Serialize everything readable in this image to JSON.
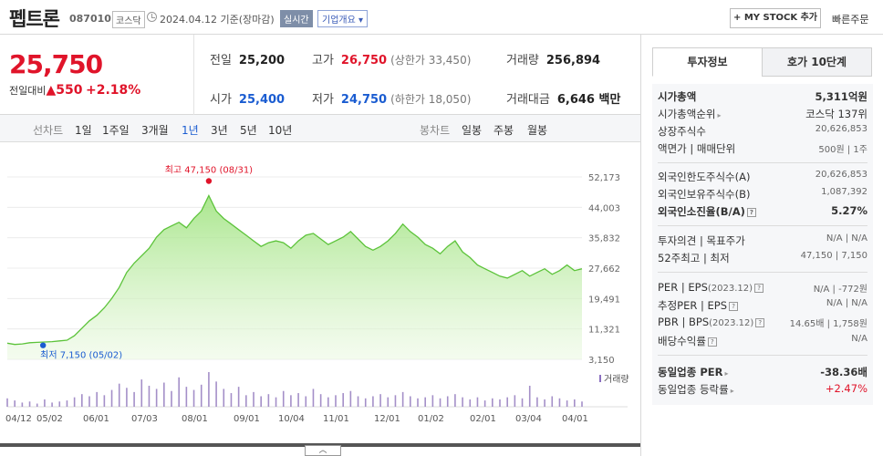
{
  "header": {
    "title": "펩트론",
    "code": "087010",
    "market": "코스닥",
    "date": "2024.04.12 기준(장마감)",
    "realtime": "실시간",
    "overview": "기업개요",
    "mystock": "+ MY STOCK 추가",
    "quick_order": "빠른주문"
  },
  "price": {
    "current": "25,750",
    "change_label": "전일대비",
    "change_arrow": "▲",
    "change": "550",
    "change_pct": "+2.18%",
    "prev_label": "전일",
    "prev": "25,200",
    "high_label": "고가",
    "high": "26,750",
    "upper_limit": "(상한가 33,450)",
    "volume_label": "거래량",
    "volume": "256,894",
    "open_label": "시가",
    "open": "25,400",
    "low_label": "저가",
    "low": "24,750",
    "lower_limit": "(하한가 18,050)",
    "amount_label": "거래대금",
    "amount": "6,646 백만"
  },
  "period_tabs": {
    "line_label": "선차트",
    "items": [
      "1일",
      "1주일",
      "3개월",
      "1년",
      "3년",
      "5년",
      "10년"
    ],
    "selected": "1년",
    "candle_label": "봉차트",
    "candle_items": [
      "일봉",
      "주봉",
      "월봉"
    ]
  },
  "chart_data": {
    "type": "area",
    "y_ticks": [
      "52,173",
      "44,003",
      "35,832",
      "27,662",
      "19,491",
      "11,321",
      "3,150"
    ],
    "ylim": [
      3150,
      52173
    ],
    "x_ticks": [
      "04/12",
      "05/02",
      "06/01",
      "07/03",
      "08/01",
      "09/01",
      "10/04",
      "11/01",
      "12/01",
      "01/02",
      "02/01",
      "03/04",
      "04/01"
    ],
    "max_label": "최고 47,150 (08/31)",
    "min_label": "최저 7,150 (05/02)",
    "volume_label": "거래량",
    "values": [
      7500,
      7150,
      7300,
      7600,
      7700,
      7800,
      7900,
      8100,
      8300,
      9500,
      11500,
      13500,
      15000,
      17000,
      19500,
      22500,
      26500,
      29000,
      31000,
      33000,
      36000,
      38000,
      39000,
      40000,
      38500,
      41000,
      43000,
      47150,
      43000,
      41000,
      39500,
      38000,
      36500,
      35000,
      33500,
      34500,
      35000,
      34500,
      33000,
      35000,
      36500,
      37000,
      35500,
      34000,
      35000,
      36000,
      37500,
      35500,
      33500,
      32500,
      33500,
      35000,
      37000,
      39500,
      37500,
      36000,
      34000,
      33000,
      31500,
      33500,
      35000,
      32000,
      30500,
      28500,
      27500,
      26500,
      25500,
      25000,
      26000,
      27000,
      25500,
      26500,
      27500,
      26000,
      27000,
      28500,
      27000,
      27500
    ],
    "volumes": [
      8,
      6,
      4,
      5,
      3,
      7,
      4,
      5,
      6,
      9,
      12,
      10,
      14,
      11,
      16,
      22,
      18,
      14,
      26,
      20,
      17,
      23,
      15,
      28,
      19,
      16,
      21,
      33,
      24,
      17,
      13,
      19,
      11,
      14,
      10,
      12,
      9,
      15,
      11,
      13,
      10,
      17,
      12,
      9,
      11,
      13,
      15,
      10,
      8,
      10,
      12,
      9,
      11,
      14,
      10,
      8,
      9,
      11,
      8,
      10,
      12,
      9,
      7,
      9,
      6,
      8,
      7,
      9,
      11,
      8,
      20,
      9,
      7,
      10,
      8,
      6,
      7,
      5
    ]
  },
  "side_panel": {
    "tabs": [
      "투자정보",
      "호가 10단계"
    ],
    "market_cap_label": "시가총액",
    "market_cap": "5,311억원",
    "market_rank_label": "시가총액순위",
    "market_rank": "코스닥 137위",
    "shares_label": "상장주식수",
    "shares": "20,626,853",
    "par_label": "액면가 | 매매단위",
    "par": "500원 | 1주",
    "foreign_limit_label": "외국인한도주식수(A)",
    "foreign_limit": "20,626,853",
    "foreign_hold_label": "외국인보유주식수(B)",
    "foreign_hold": "1,087,392",
    "foreign_rate_label": "외국인소진율(B/A)",
    "foreign_rate": "5.27%",
    "opinion_label": "투자의견 | 목표주가",
    "opinion": "N/A | N/A",
    "range_label": "52주최고 | 최저",
    "range": "47,150 | 7,150",
    "per_label": "PER | EPS",
    "per_sub": "(2023.12)",
    "per": "N/A | -772원",
    "est_per_label": "추정PER | EPS",
    "est_per": "N/A | N/A",
    "pbr_label": "PBR | BPS",
    "pbr_sub": "(2023.12)",
    "pbr": "14.65배 | 1,758원",
    "dividend_label": "배당수익률",
    "dividend": "N/A",
    "sector_per_label": "동일업종 PER",
    "sector_per": "-38.36배",
    "sector_rate_label": "동일업종 등락률",
    "sector_rate": "+2.47%"
  }
}
